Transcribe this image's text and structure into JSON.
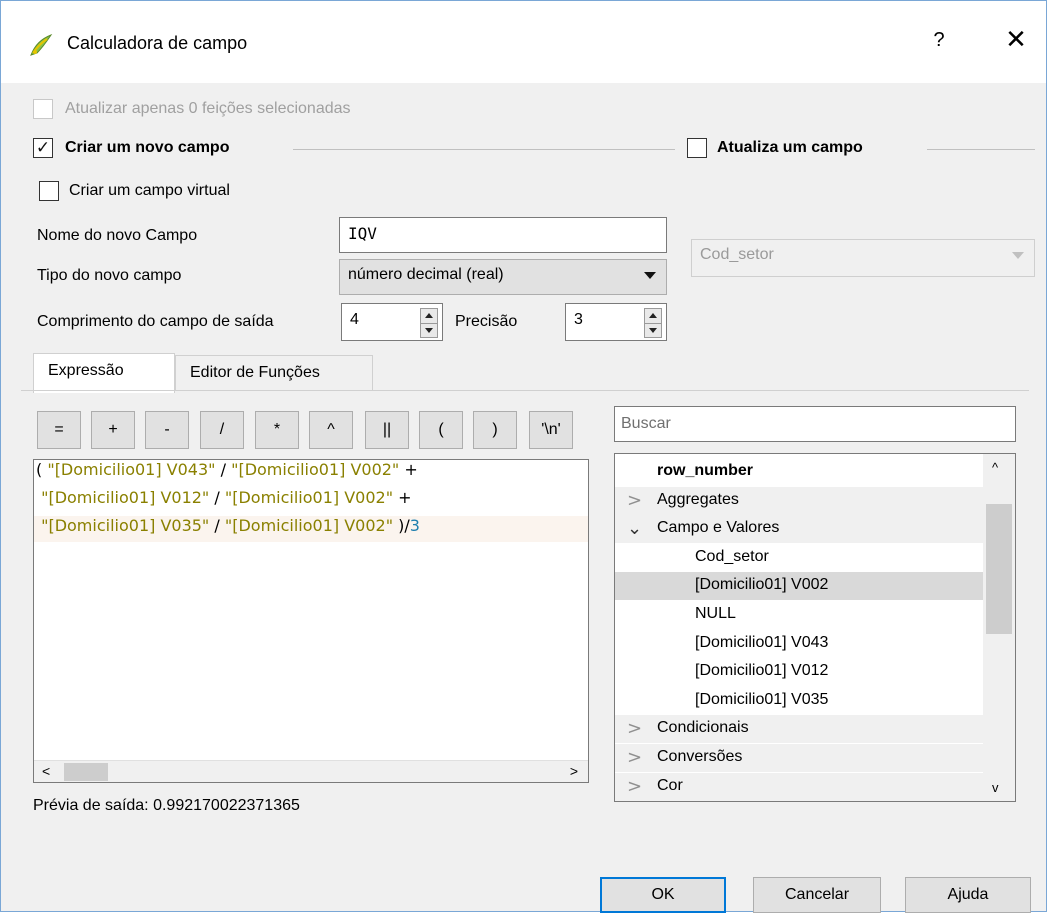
{
  "window": {
    "title": "Calculadora de campo",
    "help_glyph": "?",
    "close_glyph": "✕"
  },
  "options": {
    "update_selected_label": "Atualizar apenas 0 feições selecionadas",
    "create_new_label": "Criar um novo campo",
    "update_field_label": "Atualiza um campo",
    "virtual_label": "Criar um campo virtual",
    "name_label": "Nome do novo Campo",
    "name_value": "IQV",
    "type_label": "Tipo do novo campo",
    "type_value": "número decimal (real)",
    "length_label": "Comprimento do campo de saída",
    "length_value": "4",
    "precision_label": "Precisão",
    "precision_value": "3",
    "field_combo_value": "Cod_setor"
  },
  "tabs": {
    "expression": "Expressão",
    "functions": "Editor de Funções"
  },
  "operators": [
    "=",
    "+",
    "-",
    "/",
    "*",
    "^",
    "||",
    "(",
    ")",
    "'\\n'"
  ],
  "editor": {
    "line1": [
      {
        "t": "( ",
        "c": "op"
      },
      {
        "t": "\"[Domicilio01] V043\"",
        "c": "str"
      },
      {
        "t": " / ",
        "c": "op"
      },
      {
        "t": "\"[Domicilio01] V002\"",
        "c": "str"
      },
      {
        "t": " +",
        "c": "op"
      }
    ],
    "line2": [
      {
        "t": " ",
        "c": "op"
      },
      {
        "t": "\"[Domicilio01] V012\"",
        "c": "str"
      },
      {
        "t": " / ",
        "c": "op"
      },
      {
        "t": "\"[Domicilio01] V002\"",
        "c": "str"
      },
      {
        "t": " +",
        "c": "op"
      }
    ],
    "line3": [
      {
        "t": " ",
        "c": "op"
      },
      {
        "t": "\"[Domicilio01] V035\"",
        "c": "str"
      },
      {
        "t": " / ",
        "c": "op"
      },
      {
        "t": "\"[Domicilio01] V002\"",
        "c": "str"
      },
      {
        "t": " )/",
        "c": "op"
      },
      {
        "t": "3",
        "c": "num"
      }
    ],
    "scroll_left": "<",
    "scroll_right": ">"
  },
  "preview": {
    "label": "Prévia de saída:",
    "value": "0.992170022371365"
  },
  "search": {
    "placeholder": "Buscar"
  },
  "tree": {
    "items": [
      {
        "label": "row_number",
        "bold": true,
        "expander": "",
        "indent": 0
      },
      {
        "label": "Aggregates",
        "expander": ">",
        "indent": 0
      },
      {
        "label": "Campo e Valores",
        "expander": "⌄",
        "indent": 0
      },
      {
        "label": "Cod_setor",
        "expander": "",
        "indent": 1
      },
      {
        "label": "[Domicilio01] V002",
        "expander": "",
        "indent": 1,
        "selected": true
      },
      {
        "label": "NULL",
        "expander": "",
        "indent": 1
      },
      {
        "label": "[Domicilio01] V043",
        "expander": "",
        "indent": 1
      },
      {
        "label": "[Domicilio01] V012",
        "expander": "",
        "indent": 1
      },
      {
        "label": "[Domicilio01] V035",
        "expander": "",
        "indent": 1
      },
      {
        "label": "Condicionais",
        "expander": ">",
        "indent": 0
      },
      {
        "label": "Conversões",
        "expander": ">",
        "indent": 0
      },
      {
        "label": "Cor",
        "expander": ">",
        "indent": 0
      }
    ],
    "scroll_up": "^",
    "scroll_down": "v"
  },
  "buttons": {
    "ok": "OK",
    "cancel": "Cancelar",
    "help": "Ajuda"
  },
  "colors": {
    "string_token": "#8a8000",
    "number_token": "#1f7fae",
    "default_border": "#0078d7"
  }
}
